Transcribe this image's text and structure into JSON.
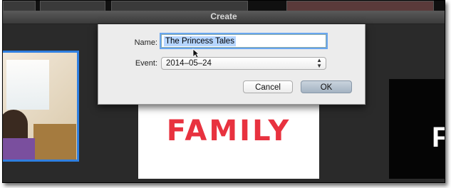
{
  "window": {
    "title": "Create"
  },
  "dialog": {
    "name_label": "Name:",
    "name_value": "The Princess Tales",
    "event_label": "Event:",
    "event_value": "2014–05–24",
    "cancel_label": "Cancel",
    "ok_label": "OK"
  },
  "content": {
    "center_clip_text": "FAMILY",
    "right_clip_letter": "F"
  },
  "colors": {
    "selection_blue": "#2f7fe0",
    "family_red": "#e8323f",
    "focus_ring": "#6aa6ef"
  }
}
